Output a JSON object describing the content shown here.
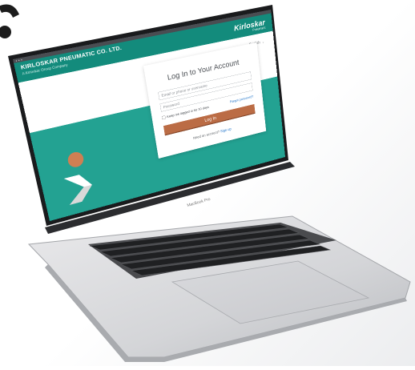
{
  "browser": {
    "dots": "●  ●  ●",
    "tabs": "",
    "status": ""
  },
  "header": {
    "company": "KIRLOSKAR PNEUMATIC CO. LTD.",
    "group": "A Kirloskar Group Company",
    "logo_word": "Kirloskar",
    "logo_sub": "Pneumatic"
  },
  "language": {
    "label": "English"
  },
  "login": {
    "title": "Log In to Your Account",
    "username_placeholder": "Email or phone or username",
    "password_placeholder": "Password",
    "keep_logged": "Keep me logged in for 30 days",
    "forgot": "Forgot password?",
    "button": "Log In",
    "need_account": "Need an account?",
    "signup": "Sign up"
  },
  "keyboard_brand": "MacBook Pro",
  "colors": {
    "teal": "#138b7c",
    "teal_light": "#23a292",
    "accent": "#bb6c45",
    "link": "#1b71c9"
  }
}
